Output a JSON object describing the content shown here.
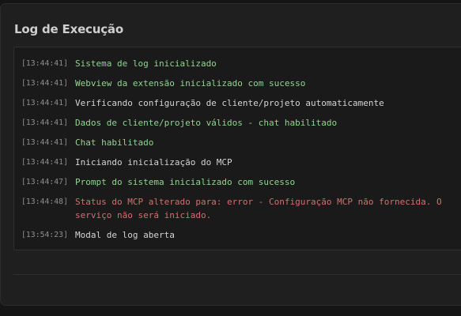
{
  "modal": {
    "title": "Log de Execução"
  },
  "log": {
    "entries": [
      {
        "time": "[13:44:41]",
        "message": "Sistema de log inicializado",
        "level": "success"
      },
      {
        "time": "[13:44:41]",
        "message": "Webview da extensão inicializado com sucesso",
        "level": "success"
      },
      {
        "time": "[13:44:41]",
        "message": "Verificando configuração de cliente/projeto automaticamente",
        "level": "info"
      },
      {
        "time": "[13:44:41]",
        "message": "Dados de cliente/projeto válidos - chat habilitado",
        "level": "success"
      },
      {
        "time": "[13:44:41]",
        "message": "Chat habilitado",
        "level": "success"
      },
      {
        "time": "[13:44:41]",
        "message": "Iniciando inicialização do MCP",
        "level": "info"
      },
      {
        "time": "[13:44:47]",
        "message": "Prompt do sistema inicializado com sucesso",
        "level": "success"
      },
      {
        "time": "[13:44:48]",
        "message": "Status do MCP alterado para: error - Configuração MCP não fornecida. O serviço não será iniciado.",
        "level": "error"
      },
      {
        "time": "[13:54:23]",
        "message": "Modal de log aberta",
        "level": "info"
      }
    ]
  },
  "colors": {
    "success": "#8fd68f",
    "info": "#d4d4d4",
    "error": "#d4706e",
    "timestamp": "#8e8e8e"
  }
}
